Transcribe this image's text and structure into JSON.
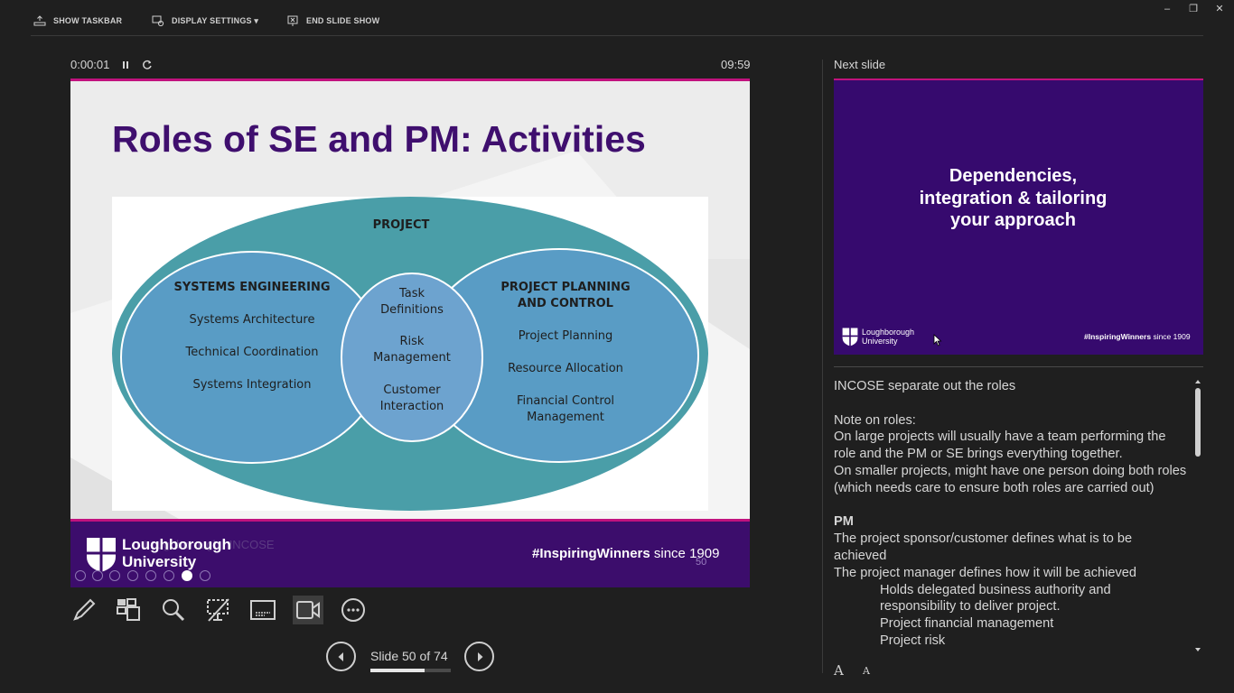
{
  "toolbar": {
    "show_taskbar": "SHOW TASKBAR",
    "display_settings": "DISPLAY SETTINGS ▾",
    "end_slide_show": "END SLIDE SHOW"
  },
  "window_controls": {
    "minimize": "–",
    "restore": "❐",
    "close": "✕"
  },
  "timer": {
    "elapsed": "0:00:01",
    "pause_icon": "pause-icon",
    "reset_icon": "reset-icon",
    "clock": "09:59"
  },
  "current_slide": {
    "title": "Roles of SE and PM: Activities",
    "venn": {
      "outer": "PROJECT",
      "left_title": "SYSTEMS ENGINEERING",
      "left_items": [
        "Systems Architecture",
        "Technical Coordination",
        "Systems Integration"
      ],
      "overlap_items": [
        [
          "Task",
          "Definitions"
        ],
        [
          "Risk",
          "Management"
        ],
        [
          "Customer",
          "Interaction"
        ]
      ],
      "right_title": [
        "PROJECT PLANNING",
        "AND CONTROL"
      ],
      "right_items": [
        [
          "Project Planning"
        ],
        [
          "Resource Allocation"
        ],
        [
          "Financial Control",
          "Management"
        ]
      ]
    },
    "footer": {
      "logo_line1": "Loughborough",
      "logo_line2": "University",
      "overlay_text": "Loughborough / INCOSE",
      "hashtag_bold": "#InspiringWinners",
      "hashtag_rest": " since 1909",
      "slide_number": "50"
    }
  },
  "colors": {
    "slide_purple": "#3c0d6c",
    "slide_pink": "#c1127e",
    "title_purple": "#3f0f6e",
    "venn_outer": "#4a9ea8",
    "venn_inner": "#5a9cc6",
    "app_background": "#1f1f1f"
  },
  "nav": {
    "slide_counter": "Slide 50 of 74",
    "progress": 0.676,
    "prev_icon": "chevron-left-icon",
    "next_icon": "chevron-right-icon"
  },
  "next_slide": {
    "label": "Next slide",
    "title": "Dependencies,\nintegration & tailoring\nyour approach",
    "logo_line1": "Loughborough",
    "logo_line2": "University",
    "hashtag_bold": "#InspiringWinners",
    "hashtag_rest": " since 1909"
  },
  "notes": {
    "line1": "INCOSE separate out the roles",
    "note_heading": "Note on roles:",
    "para1": "On large projects will usually have a team performing the role and the PM or SE brings everything together.",
    "para2": "On smaller projects, might have one person doing both roles (which needs care to ensure both roles are carried out)",
    "pm_heading": "PM",
    "pm1": "The project sponsor/customer defines what is to be achieved",
    "pm2": "The project manager defines how it will be achieved",
    "pm3": "Holds delegated business authority and responsibility to deliver project.",
    "pm4": "Project financial management",
    "pm5": "Project risk"
  },
  "font_controls": {
    "increase": "A",
    "decrease": "A"
  }
}
